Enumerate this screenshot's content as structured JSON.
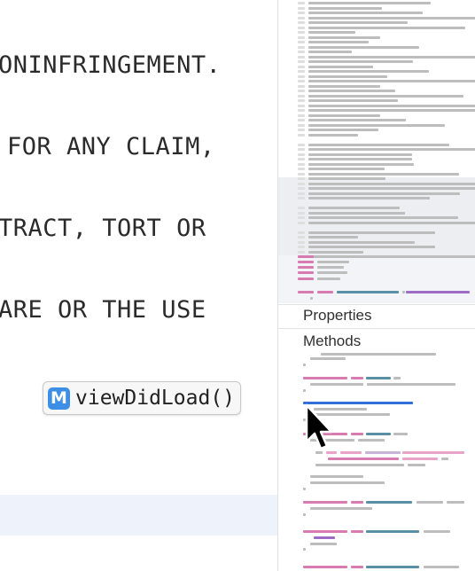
{
  "editor": {
    "lines": [
      "ONINFRINGEMENT.",
      "FOR ANY CLAIM,",
      "TRACT, TORT OR",
      "ARE OR THE USE"
    ],
    "symbol_popup": {
      "badge": "M",
      "name": "viewDidLoad()"
    }
  },
  "minimap": {
    "sections": {
      "properties": "Properties",
      "methods": "Methods"
    }
  },
  "colors": {
    "badge_blue": "#3d8fe6",
    "minimap_gray": "#bdbdbd",
    "minimap_pink": "#d77bb0",
    "minimap_teal": "#5a90a6",
    "minimap_purple": "#9d6cc4",
    "minimap_blue": "#2f6fd6",
    "line_highlight": "#eef3fb"
  },
  "icons": {
    "cursor": "arrow-pointer-icon"
  }
}
